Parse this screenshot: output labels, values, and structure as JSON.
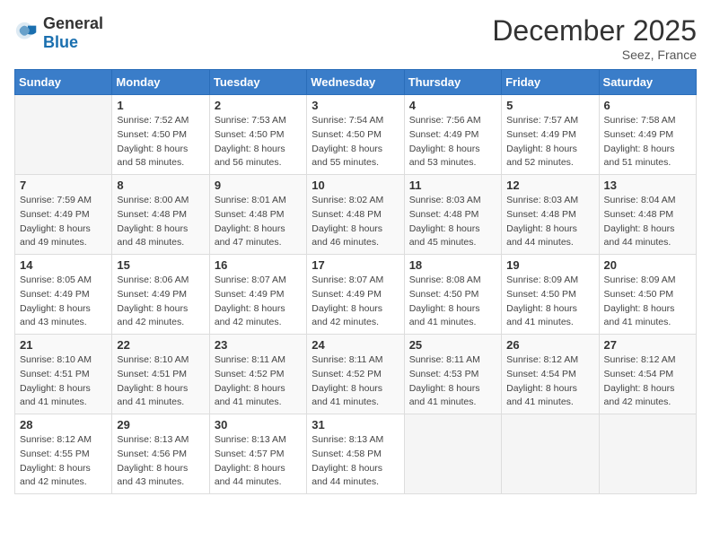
{
  "header": {
    "logo_general": "General",
    "logo_blue": "Blue",
    "title": "December 2025",
    "location": "Seez, France"
  },
  "days_of_week": [
    "Sunday",
    "Monday",
    "Tuesday",
    "Wednesday",
    "Thursday",
    "Friday",
    "Saturday"
  ],
  "weeks": [
    [
      {
        "day": "",
        "sunrise": "",
        "sunset": "",
        "daylight": ""
      },
      {
        "day": "1",
        "sunrise": "7:52 AM",
        "sunset": "4:50 PM",
        "daylight": "8 hours and 58 minutes."
      },
      {
        "day": "2",
        "sunrise": "7:53 AM",
        "sunset": "4:50 PM",
        "daylight": "8 hours and 56 minutes."
      },
      {
        "day": "3",
        "sunrise": "7:54 AM",
        "sunset": "4:50 PM",
        "daylight": "8 hours and 55 minutes."
      },
      {
        "day": "4",
        "sunrise": "7:56 AM",
        "sunset": "4:49 PM",
        "daylight": "8 hours and 53 minutes."
      },
      {
        "day": "5",
        "sunrise": "7:57 AM",
        "sunset": "4:49 PM",
        "daylight": "8 hours and 52 minutes."
      },
      {
        "day": "6",
        "sunrise": "7:58 AM",
        "sunset": "4:49 PM",
        "daylight": "8 hours and 51 minutes."
      }
    ],
    [
      {
        "day": "7",
        "sunrise": "7:59 AM",
        "sunset": "4:49 PM",
        "daylight": "8 hours and 49 minutes."
      },
      {
        "day": "8",
        "sunrise": "8:00 AM",
        "sunset": "4:48 PM",
        "daylight": "8 hours and 48 minutes."
      },
      {
        "day": "9",
        "sunrise": "8:01 AM",
        "sunset": "4:48 PM",
        "daylight": "8 hours and 47 minutes."
      },
      {
        "day": "10",
        "sunrise": "8:02 AM",
        "sunset": "4:48 PM",
        "daylight": "8 hours and 46 minutes."
      },
      {
        "day": "11",
        "sunrise": "8:03 AM",
        "sunset": "4:48 PM",
        "daylight": "8 hours and 45 minutes."
      },
      {
        "day": "12",
        "sunrise": "8:03 AM",
        "sunset": "4:48 PM",
        "daylight": "8 hours and 44 minutes."
      },
      {
        "day": "13",
        "sunrise": "8:04 AM",
        "sunset": "4:48 PM",
        "daylight": "8 hours and 44 minutes."
      }
    ],
    [
      {
        "day": "14",
        "sunrise": "8:05 AM",
        "sunset": "4:49 PM",
        "daylight": "8 hours and 43 minutes."
      },
      {
        "day": "15",
        "sunrise": "8:06 AM",
        "sunset": "4:49 PM",
        "daylight": "8 hours and 42 minutes."
      },
      {
        "day": "16",
        "sunrise": "8:07 AM",
        "sunset": "4:49 PM",
        "daylight": "8 hours and 42 minutes."
      },
      {
        "day": "17",
        "sunrise": "8:07 AM",
        "sunset": "4:49 PM",
        "daylight": "8 hours and 42 minutes."
      },
      {
        "day": "18",
        "sunrise": "8:08 AM",
        "sunset": "4:50 PM",
        "daylight": "8 hours and 41 minutes."
      },
      {
        "day": "19",
        "sunrise": "8:09 AM",
        "sunset": "4:50 PM",
        "daylight": "8 hours and 41 minutes."
      },
      {
        "day": "20",
        "sunrise": "8:09 AM",
        "sunset": "4:50 PM",
        "daylight": "8 hours and 41 minutes."
      }
    ],
    [
      {
        "day": "21",
        "sunrise": "8:10 AM",
        "sunset": "4:51 PM",
        "daylight": "8 hours and 41 minutes."
      },
      {
        "day": "22",
        "sunrise": "8:10 AM",
        "sunset": "4:51 PM",
        "daylight": "8 hours and 41 minutes."
      },
      {
        "day": "23",
        "sunrise": "8:11 AM",
        "sunset": "4:52 PM",
        "daylight": "8 hours and 41 minutes."
      },
      {
        "day": "24",
        "sunrise": "8:11 AM",
        "sunset": "4:52 PM",
        "daylight": "8 hours and 41 minutes."
      },
      {
        "day": "25",
        "sunrise": "8:11 AM",
        "sunset": "4:53 PM",
        "daylight": "8 hours and 41 minutes."
      },
      {
        "day": "26",
        "sunrise": "8:12 AM",
        "sunset": "4:54 PM",
        "daylight": "8 hours and 41 minutes."
      },
      {
        "day": "27",
        "sunrise": "8:12 AM",
        "sunset": "4:54 PM",
        "daylight": "8 hours and 42 minutes."
      }
    ],
    [
      {
        "day": "28",
        "sunrise": "8:12 AM",
        "sunset": "4:55 PM",
        "daylight": "8 hours and 42 minutes."
      },
      {
        "day": "29",
        "sunrise": "8:13 AM",
        "sunset": "4:56 PM",
        "daylight": "8 hours and 43 minutes."
      },
      {
        "day": "30",
        "sunrise": "8:13 AM",
        "sunset": "4:57 PM",
        "daylight": "8 hours and 44 minutes."
      },
      {
        "day": "31",
        "sunrise": "8:13 AM",
        "sunset": "4:58 PM",
        "daylight": "8 hours and 44 minutes."
      },
      {
        "day": "",
        "sunrise": "",
        "sunset": "",
        "daylight": ""
      },
      {
        "day": "",
        "sunrise": "",
        "sunset": "",
        "daylight": ""
      },
      {
        "day": "",
        "sunrise": "",
        "sunset": "",
        "daylight": ""
      }
    ]
  ]
}
